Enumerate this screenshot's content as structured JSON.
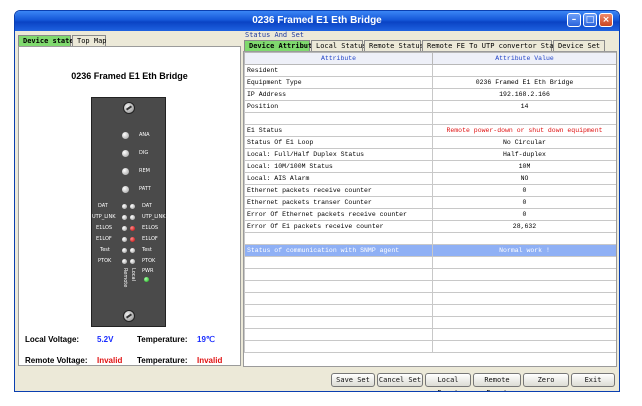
{
  "window": {
    "title": "0236 Framed E1 Eth Bridge"
  },
  "left_tabs": [
    {
      "label": "Device state"
    },
    {
      "label": "Top Map"
    }
  ],
  "device": {
    "title": "0236 Framed E1 Eth Bridge",
    "indicators": [
      "ANA",
      "DIG",
      "REM",
      "PATT"
    ],
    "led_rows": [
      {
        "left": "DAT",
        "right": "DAT"
      },
      {
        "left": "UTP_LINK",
        "right": "UTP_LINK"
      },
      {
        "left": "E1LOS",
        "right": "E1LOS"
      },
      {
        "left": "E1LOF",
        "right": "E1LOF"
      },
      {
        "left": "Test",
        "right": "Test"
      },
      {
        "left": "PTOK",
        "right": "PTOK"
      }
    ],
    "side_labels": {
      "remote": "Remote",
      "local": "Local"
    },
    "pwr_label": "PWR",
    "colors": {
      "active_led": "#c00000",
      "power_led": "#10b010"
    }
  },
  "voltage": {
    "local_voltage_label": "Local  Voltage:",
    "local_voltage_value": "5.2V",
    "local_temp_label": "Temperature:",
    "local_temp_value": "19℃",
    "remote_voltage_label": "Remote Voltage:",
    "remote_voltage_value": "Invalid",
    "remote_temp_label": "Temperature:",
    "remote_temp_value": "Invalid"
  },
  "status_group": {
    "label": "Status And Set"
  },
  "right_tabs": [
    {
      "label": "Device Attribute"
    },
    {
      "label": "Local Status"
    },
    {
      "label": "Remote Status"
    },
    {
      "label": "Remote FE To UTP convertor Status"
    },
    {
      "label": "Device Set"
    }
  ],
  "table": {
    "headers": [
      "Attribute",
      "Attribute Value"
    ],
    "rows": [
      [
        "Resident",
        ""
      ],
      [
        "Equipment Type",
        "0236 Framed E1 Eth Bridge"
      ],
      [
        "IP Address",
        "192.168.2.166"
      ],
      [
        "Position",
        "14"
      ],
      [
        "",
        ""
      ],
      [
        "E1 Status",
        "Remote power-down or shut down equipment"
      ],
      [
        "Status Of E1 Loop",
        "No Circular"
      ],
      [
        "Local: Full/Half Duplex Status",
        "Half-duplex"
      ],
      [
        "Local: 10M/100M Status",
        "10M"
      ],
      [
        "Local: AIS Alarm",
        "NO"
      ],
      [
        "Ethernet packets receive counter",
        "0"
      ],
      [
        "Ethernet packets transer Counter",
        "0"
      ],
      [
        "Error Of Ethernet packets receive counter",
        "0"
      ],
      [
        "Error Of E1 packets receive counter",
        "28,632"
      ],
      [
        "",
        ""
      ],
      [
        "Status of communication with SNMP agent",
        "Normal work !"
      ],
      [
        "",
        ""
      ],
      [
        "",
        ""
      ],
      [
        "",
        ""
      ],
      [
        "",
        ""
      ],
      [
        "",
        ""
      ],
      [
        "",
        ""
      ],
      [
        "",
        ""
      ],
      [
        "",
        ""
      ]
    ],
    "highlight_value_color": "#e01010"
  },
  "buttons": [
    {
      "label": "Save Set"
    },
    {
      "label": "Cancel Set"
    },
    {
      "label": "Local Reset"
    },
    {
      "label": "Remote Reset"
    },
    {
      "label": "Zero"
    },
    {
      "label": "Exit"
    }
  ]
}
